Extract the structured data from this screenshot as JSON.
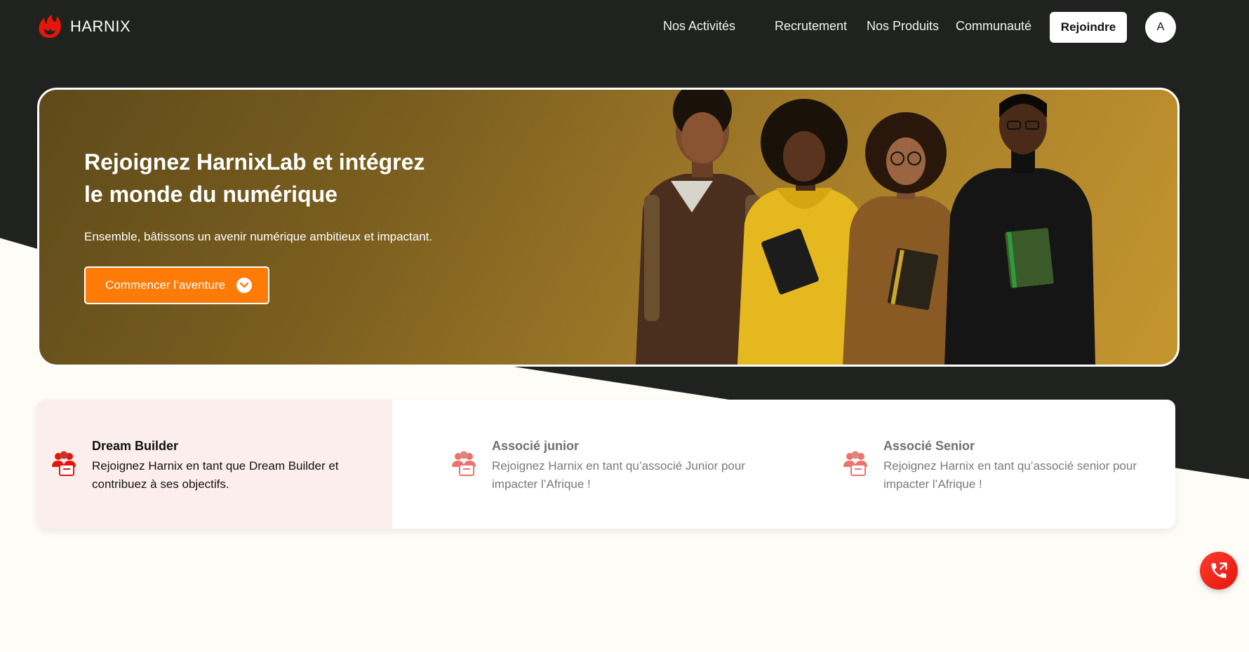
{
  "brand": {
    "name": "HARNIX",
    "logo_icon": "harnix-flame-logo",
    "accent": "#e4160c"
  },
  "nav": {
    "links": [
      "Nos Activités",
      "Recrutement",
      "Nos Produits",
      "Communauté"
    ],
    "join_label": "Rejoindre",
    "avatar_letter": "A"
  },
  "hero": {
    "title_line1": "Rejoignez HarnixLab et intégrez",
    "title_line2": "le monde du numérique",
    "subtitle": "Ensemble, bâtissons un avenir numérique ambitieux et impactant.",
    "cta_label": "Commencer l’aventure",
    "cta_color": "#ff7b07",
    "image": "group-of-four-students-photo"
  },
  "cards": [
    {
      "title": "Dream Builder",
      "text": "Rejoignez Harnix en tant que Dream Builder et contribuez à ses objectifs.",
      "active": true,
      "icon": "team-briefcase-icon"
    },
    {
      "title": "Associé junior",
      "text": "Rejoignez Harnix en tant qu’associé Junior pour impacter l’Afrique !",
      "active": false,
      "icon": "team-briefcase-icon"
    },
    {
      "title": "Associé Senior",
      "text": "Rejoignez Harnix en tant qu’associé senior pour impacter l’Afrique !",
      "active": false,
      "icon": "team-briefcase-icon"
    }
  ],
  "floating": {
    "icon": "phone-call-icon"
  }
}
